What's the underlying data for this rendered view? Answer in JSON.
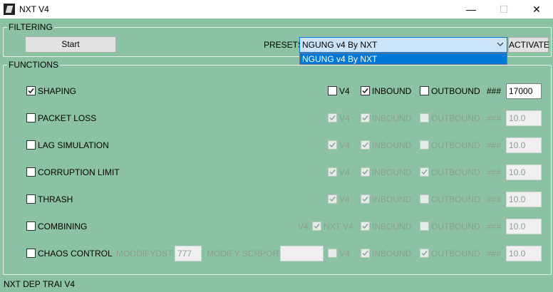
{
  "window": {
    "title": "NXT V4"
  },
  "filtering": {
    "legend": "FILTERING",
    "start_label": "Start",
    "presets_label": "PRESETS",
    "preset_selected": "NGUNG v4 By NXT",
    "preset_options": [
      "NGUNG v4 By NXT"
    ],
    "activate_label": "ACTIVATE"
  },
  "functions": {
    "legend": "FUNCTIONS",
    "rows": [
      {
        "label": "SHAPING",
        "checked": true,
        "enabled": true,
        "v4": false,
        "inbound": true,
        "outbound": false,
        "hash": "###",
        "value": "17000"
      },
      {
        "label": "PACKET LOSS",
        "checked": false,
        "enabled": false,
        "v4": true,
        "inbound": true,
        "outbound": false,
        "hash": "###",
        "value": "10.0"
      },
      {
        "label": "LAG SIMULATION",
        "checked": false,
        "enabled": false,
        "v4": true,
        "inbound": true,
        "outbound": false,
        "hash": "###",
        "value": "10.0"
      },
      {
        "label": "CORRUPTION LIMIT",
        "checked": false,
        "enabled": false,
        "v4": true,
        "inbound": true,
        "outbound": true,
        "hash": "###",
        "value": "10.0"
      },
      {
        "label": "THRASH",
        "checked": false,
        "enabled": false,
        "v4": true,
        "inbound": true,
        "outbound": false,
        "hash": "###",
        "value": "10.0"
      },
      {
        "label": "COMBINING",
        "checked": false,
        "enabled": false,
        "v4": false,
        "inbound": true,
        "outbound": false,
        "hash": "###",
        "value": "10.0"
      },
      {
        "label": "CHAOS CONTROL",
        "checked": false,
        "enabled": false,
        "v4": false,
        "inbound": true,
        "outbound": true,
        "hash": "###",
        "value": "10.0"
      }
    ],
    "col_v4": "V4",
    "col_inbound": "INBOUND",
    "col_outbound": "OUTBOUND",
    "combining_extra": {
      "v4_label": "V4",
      "nxtv4_label": "NXT V4",
      "nxtv4_checked": true
    },
    "chaos_extra": {
      "moddifydst_label": "MODDIFYDST",
      "moddifydst_value": "777",
      "modifyscrport_label": "MODIFY SCRPORT",
      "modifyscrport_value": ""
    }
  },
  "status": {
    "text": "NXT DEP TRAI V4"
  }
}
